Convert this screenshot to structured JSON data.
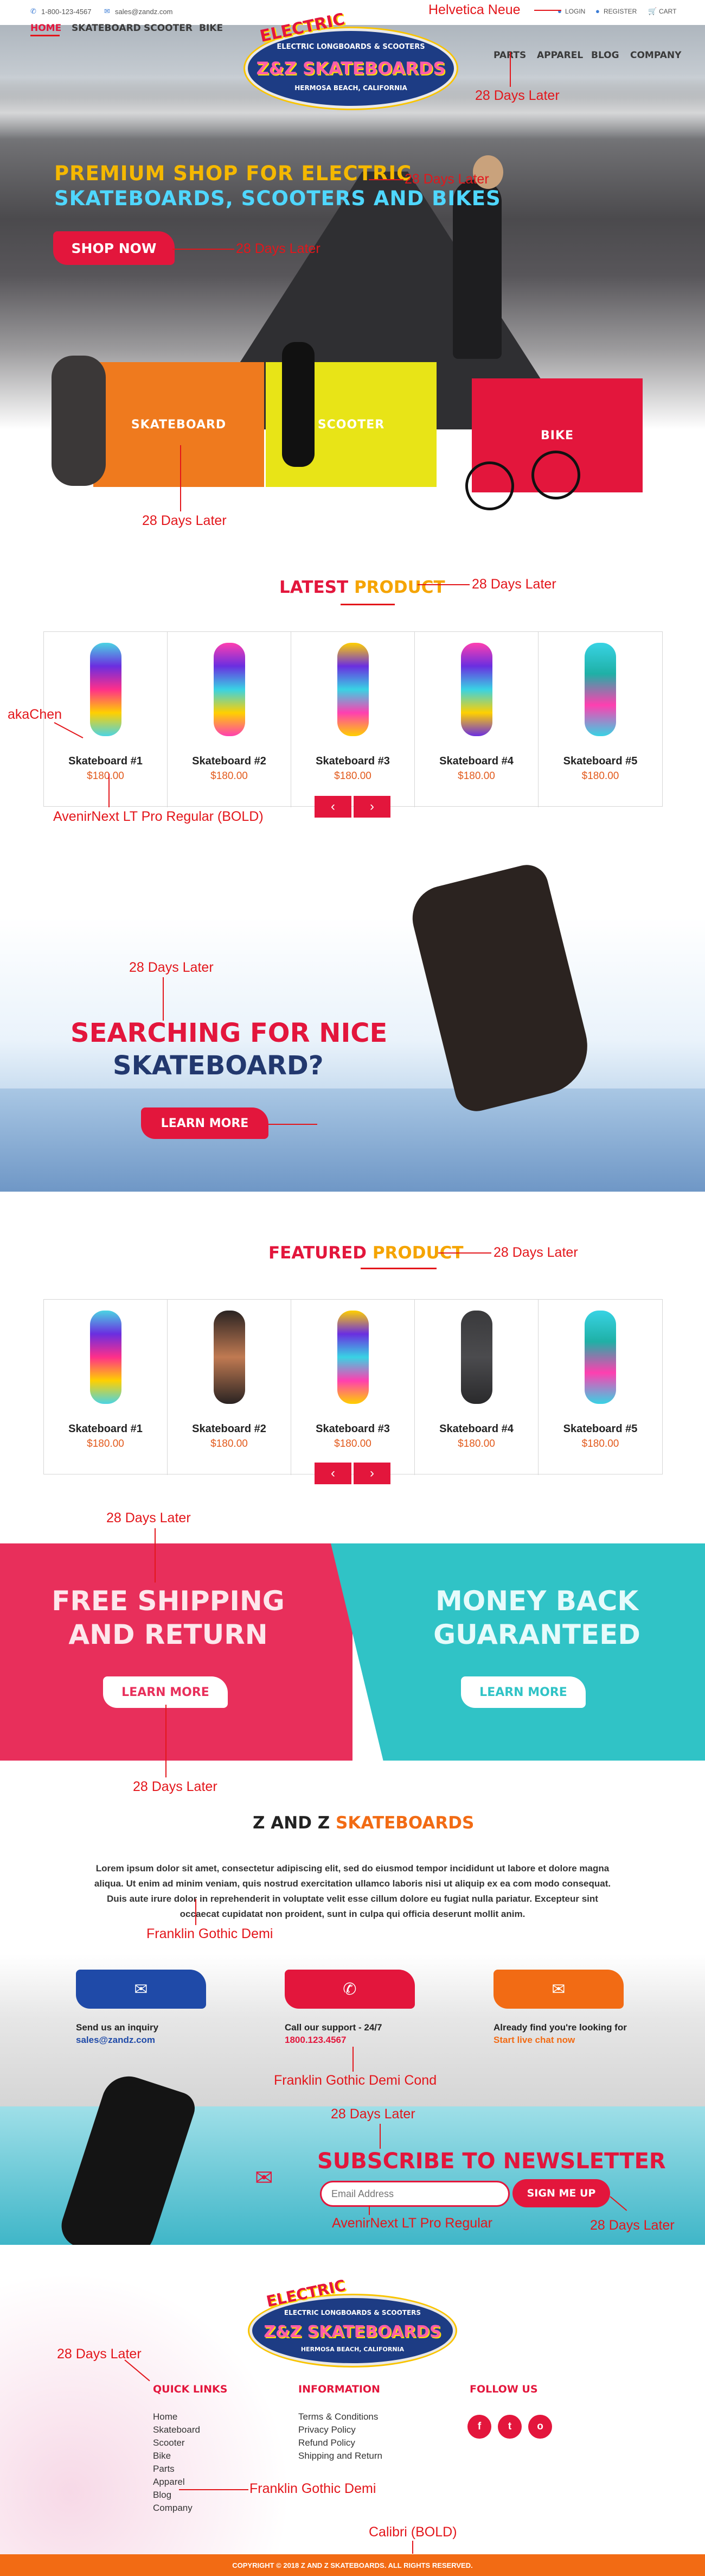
{
  "topbar": {
    "phone": "1-800-123-4567",
    "email": "sales@zandz.com",
    "login": "LOGIN",
    "register": "REGISTER",
    "cart": "CART"
  },
  "nav": {
    "left": [
      "HOME",
      "SKATEBOARD",
      "SCOOTER",
      "BIKE"
    ],
    "right": [
      "PARTS",
      "APPAREL",
      "BLOG",
      "COMPANY"
    ]
  },
  "logo": {
    "top": "ELECTRIC",
    "main": "Z&Z SKATEBOARDS",
    "sub1": "ELECTRIC LONGBOARDS & SCOOTERS",
    "sub2": "HERMOSA BEACH, CALIFORNIA"
  },
  "hero": {
    "line1": "PREMIUM SHOP FOR ELECTRIC",
    "line2": "SKATEBOARDS, SCOOTERS AND BIKES",
    "cta": "SHOP NOW"
  },
  "categories": [
    "SKATEBOARD",
    "SCOOTER",
    "BIKE"
  ],
  "latest": {
    "title_a": "LATEST ",
    "title_b": "PRODUCT",
    "items": [
      {
        "name": "Skateboard #1",
        "price": "$180.00"
      },
      {
        "name": "Skateboard #2",
        "price": "$180.00"
      },
      {
        "name": "Skateboard #3",
        "price": "$180.00"
      },
      {
        "name": "Skateboard #4",
        "price": "$180.00"
      },
      {
        "name": "Skateboard #5",
        "price": "$180.00"
      }
    ]
  },
  "search_banner": {
    "line1": "SEARCHING FOR NICE",
    "line2": "SKATEBOARD?",
    "cta": "LEARN MORE"
  },
  "featured": {
    "title_a": "FEATURED ",
    "title_b": "PRODUCT",
    "items": [
      {
        "name": "Skateboard #1",
        "price": "$180.00"
      },
      {
        "name": "Skateboard #2",
        "price": "$180.00"
      },
      {
        "name": "Skateboard #3",
        "price": "$180.00"
      },
      {
        "name": "Skateboard #4",
        "price": "$180.00"
      },
      {
        "name": "Skateboard #5",
        "price": "$180.00"
      }
    ]
  },
  "promo": {
    "left_1": "FREE SHIPPING",
    "left_2": "AND RETURN",
    "right_1": "MONEY BACK",
    "right_2": "GUARANTEED",
    "cta": "LEARN MORE"
  },
  "about": {
    "title_a": "Z AND Z ",
    "title_b": "SKATEBOARDS",
    "text": "Lorem ipsum dolor sit amet, consectetur adipiscing elit, sed do eiusmod tempor incididunt ut labore et dolore magna aliqua. Ut enim ad minim veniam, quis nostrud exercitation ullamco laboris nisi ut aliquip ex ea com modo consequat. Duis aute irure dolor in reprehenderit in voluptate velit esse cillum dolore eu fugiat nulla pariatur. Excepteur sint occaecat cupidatat non proident, sunt in culpa qui officia deserunt mollit anim."
  },
  "contact": [
    {
      "label": "Send us an inquiry",
      "value": "sales@zandz.com",
      "icon": "envelope-icon"
    },
    {
      "label": "Call our support - 24/7",
      "value": "1800.123.4567",
      "icon": "phone-icon"
    },
    {
      "label": "Already find you're looking for",
      "value": "Start live chat now",
      "icon": "chat-icon"
    }
  ],
  "newsletter": {
    "title": "SUBSCRIBE TO NEWSLETTER",
    "placeholder": "Email Address",
    "button": "SIGN ME UP"
  },
  "footer": {
    "quick_title": "QUICK LINKS",
    "quick": [
      "Home",
      "Skateboard",
      "Scooter",
      "Bike",
      "Parts",
      "Apparel",
      "Blog",
      "Company"
    ],
    "info_title": "INFORMATION",
    "info": [
      "Terms & Conditions",
      "Privacy Policy",
      "Refund Policy",
      "Shipping and Return"
    ],
    "follow_title": "FOLLOW US",
    "social": [
      "f",
      "t",
      "o"
    ],
    "copyright": "COPYRIGHT © 2018 Z AND Z SKATEBOARDS. ALL RIGHTS RESERVED."
  },
  "annotations": {
    "helvetica": "Helvetica Neue",
    "days": "28 Days Later",
    "akachen": "akaChen",
    "avenir_bold": "AvenirNext LT Pro Regular (BOLD)",
    "franklin": "Franklin Gothic Demi",
    "franklin_cond": "Franklin Gothic Demi Cond",
    "avenir": "AvenirNext LT Pro Regular",
    "calibri": "Calibri (BOLD)"
  },
  "colors": {
    "accent": "#e3163c",
    "orange": "#e25a1c",
    "annotation": "#e3161b",
    "teal": "#30c3c6",
    "blue": "#1f4aa8"
  }
}
